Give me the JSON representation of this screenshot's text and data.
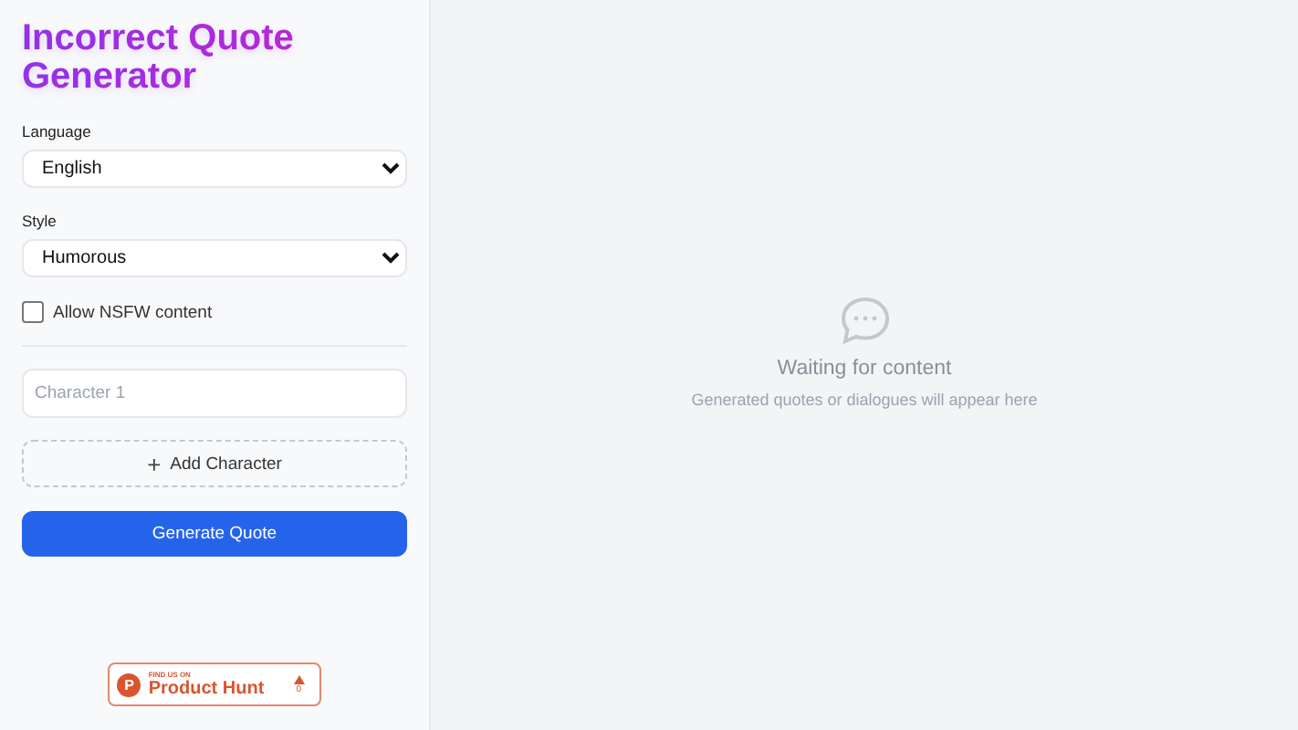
{
  "sidebar": {
    "title": "Incorrect Quote Generator",
    "fields": [
      {
        "kind": "select",
        "label": "Language",
        "value": "English"
      },
      {
        "kind": "select",
        "label": "Style",
        "value": "Humorous"
      }
    ],
    "nsfw": {
      "label": "Allow NSFW content",
      "checked": false
    },
    "characters": [
      {
        "placeholder": "Character 1"
      }
    ],
    "add_button": {
      "icon": "+",
      "label": "Add Character"
    },
    "generate_button": "Generate Quote",
    "badge": {
      "kicker": "FIND US ON",
      "name": "Product Hunt",
      "logo": "P",
      "count": "0"
    }
  },
  "main": {
    "title": "Waiting for content",
    "subtitle": "Generated quotes or dialogues will appear here"
  }
}
